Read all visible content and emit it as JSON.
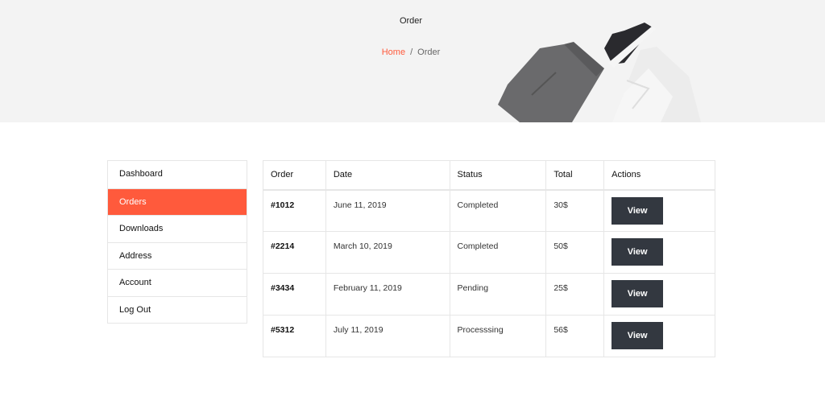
{
  "banner": {
    "title": "Order",
    "breadcrumb": {
      "home": "Home",
      "separator": "/",
      "current": "Order"
    }
  },
  "colors": {
    "accent": "#ff5a3c",
    "button_dark": "#333840",
    "banner_bg": "#f3f3f3"
  },
  "sidebar": {
    "items": [
      {
        "label": "Dashboard",
        "active": false
      },
      {
        "label": "Orders",
        "active": true
      },
      {
        "label": "Downloads",
        "active": false
      },
      {
        "label": "Address",
        "active": false
      },
      {
        "label": "Account",
        "active": false
      },
      {
        "label": "Log Out",
        "active": false
      }
    ]
  },
  "table": {
    "headers": [
      "Order",
      "Date",
      "Status",
      "Total",
      "Actions"
    ],
    "rows": [
      {
        "order": "#1012",
        "date": "June 11, 2019",
        "status": "Completed",
        "total": "30$",
        "action": "View"
      },
      {
        "order": "#2214",
        "date": "March 10, 2019",
        "status": "Completed",
        "total": "50$",
        "action": "View"
      },
      {
        "order": "#3434",
        "date": "February 11, 2019",
        "status": "Pending",
        "total": "25$",
        "action": "View"
      },
      {
        "order": "#5312",
        "date": "July 11, 2019",
        "status": "Processsing",
        "total": "56$",
        "action": "View"
      }
    ]
  },
  "banner_image": {
    "icon": "clothing-flatlay-image"
  }
}
